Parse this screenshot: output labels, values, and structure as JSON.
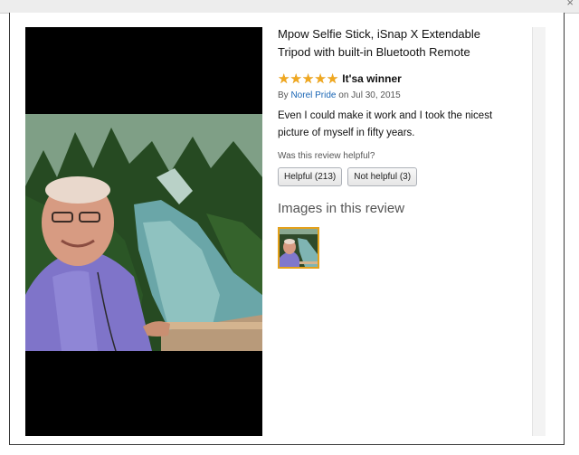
{
  "product": {
    "title_line1": "Mpow Selfie Stick, iSnap X Extendable",
    "title_line2": "Tripod with built-in Bluetooth Remote"
  },
  "review": {
    "rating": 5,
    "rating_max": 5,
    "title": "It'sa winner",
    "by_prefix": "By",
    "author": "Norel Pride",
    "date_text": "on Jul 30, 2015",
    "body_line1": "Even I could make it work and I took the nicest",
    "body_line2": "picture of myself in fifty years.",
    "helpful_question": "Was this review helpful?",
    "helpful_button": "Helpful (213)",
    "not_helpful_button": "Not helpful (3)"
  },
  "images_section": {
    "heading": "Images in this review"
  },
  "colors": {
    "star": "#f0a820",
    "author_link": "#1a66b5",
    "thumb_border": "#e4a11b"
  },
  "icons": {
    "close": "close-icon",
    "star": "star-icon"
  }
}
